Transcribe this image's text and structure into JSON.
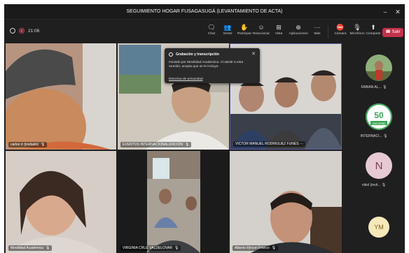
{
  "window": {
    "title": "SEGUIMIENTO HOGAR FUSAGASUGÁ (LEVANTAMIENTO DE ACTA)"
  },
  "meeting": {
    "timer": "21:06"
  },
  "toolbar": {
    "chat": "Chat",
    "people": "Gente",
    "raise": "Participar",
    "react": "Reaccionar",
    "view": "Vista",
    "apps": "Aplicaciones",
    "more": "Más",
    "camera": "Cámara",
    "mic": "Micrófono",
    "share": "Comparte",
    "leave": "Salir"
  },
  "banner": {
    "title": "Grabación y transcripción",
    "body": "Iniciado por Movilidad Academica. Al asistir a esta reunión, acepta que se le incluya.",
    "link": "Directiva de privacidad"
  },
  "tiles": [
    {
      "name": "carlos rr (invitado)"
    },
    {
      "name": "EVENTOS INTERNACIONALIZACIÓN"
    },
    {
      "name": "VICTOR MANUEL RODRIGUEZ FUNES",
      "more": "···"
    },
    {
      "name": "Movilidad Academica"
    },
    {
      "name": "VIRGINIA CRUZ VALDELOVAR"
    },
    {
      "name": "Alberto Rincon Franco"
    }
  ],
  "panel": [
    {
      "name": "FABIAN AL..."
    },
    {
      "name": "INTERNACI...",
      "logo_text": "50",
      "logo_sub": "UNICARIBE"
    },
    {
      "name": "nikol (invit...",
      "initials": "N"
    },
    {
      "name": "",
      "initials": "YM"
    }
  ],
  "colors": {
    "leave": "#c4314b",
    "accent": "#6264a7",
    "panel_n": "#e7c9d4",
    "panel_ym": "#f5e8b9"
  }
}
